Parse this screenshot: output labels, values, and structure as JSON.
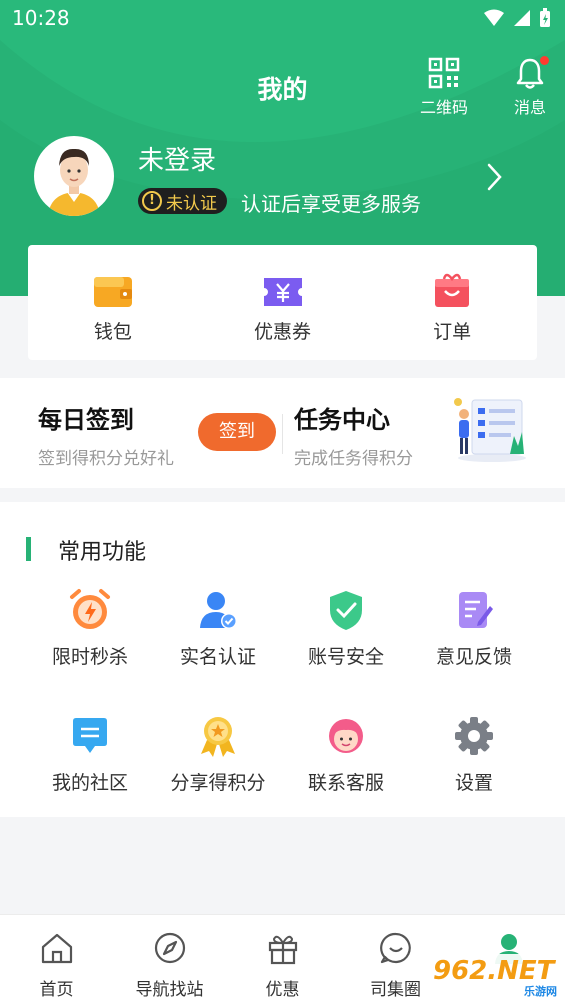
{
  "status_bar": {
    "time": "10:28"
  },
  "header": {
    "title": "我的",
    "qr_label": "二维码",
    "message_label": "消息"
  },
  "user": {
    "name": "未登录",
    "badge": "未认证",
    "hint": "认证后享受更多服务"
  },
  "quick_links": [
    {
      "label": "钱包",
      "icon": "wallet-icon"
    },
    {
      "label": "优惠券",
      "icon": "coupon-icon"
    },
    {
      "label": "订单",
      "icon": "order-icon"
    }
  ],
  "checkin": {
    "title": "每日签到",
    "subtitle": "签到得积分兑好礼",
    "button": "签到"
  },
  "task": {
    "title": "任务中心",
    "subtitle": "完成任务得积分"
  },
  "common": {
    "title": "常用功能",
    "items": [
      {
        "label": "限时秒杀",
        "icon": "alarm-clock-icon"
      },
      {
        "label": "实名认证",
        "icon": "verified-user-icon"
      },
      {
        "label": "账号安全",
        "icon": "shield-icon"
      },
      {
        "label": "意见反馈",
        "icon": "feedback-icon"
      },
      {
        "label": "我的社区",
        "icon": "community-chat-icon"
      },
      {
        "label": "分享得积分",
        "icon": "medal-icon"
      },
      {
        "label": "联系客服",
        "icon": "customer-service-icon"
      },
      {
        "label": "设置",
        "icon": "gear-icon"
      }
    ]
  },
  "tabs": [
    {
      "label": "首页",
      "icon": "home-icon"
    },
    {
      "label": "导航找站",
      "icon": "compass-icon"
    },
    {
      "label": "优惠",
      "icon": "gift-icon"
    },
    {
      "label": "司集圈",
      "icon": "chat-circle-icon"
    },
    {
      "label": "",
      "icon": "profile-icon",
      "active": true
    }
  ],
  "watermark": {
    "main": "962.NET",
    "sub": "乐游网"
  },
  "colors": {
    "primary": "#27b276",
    "checkin_button": "#f06a2d"
  }
}
